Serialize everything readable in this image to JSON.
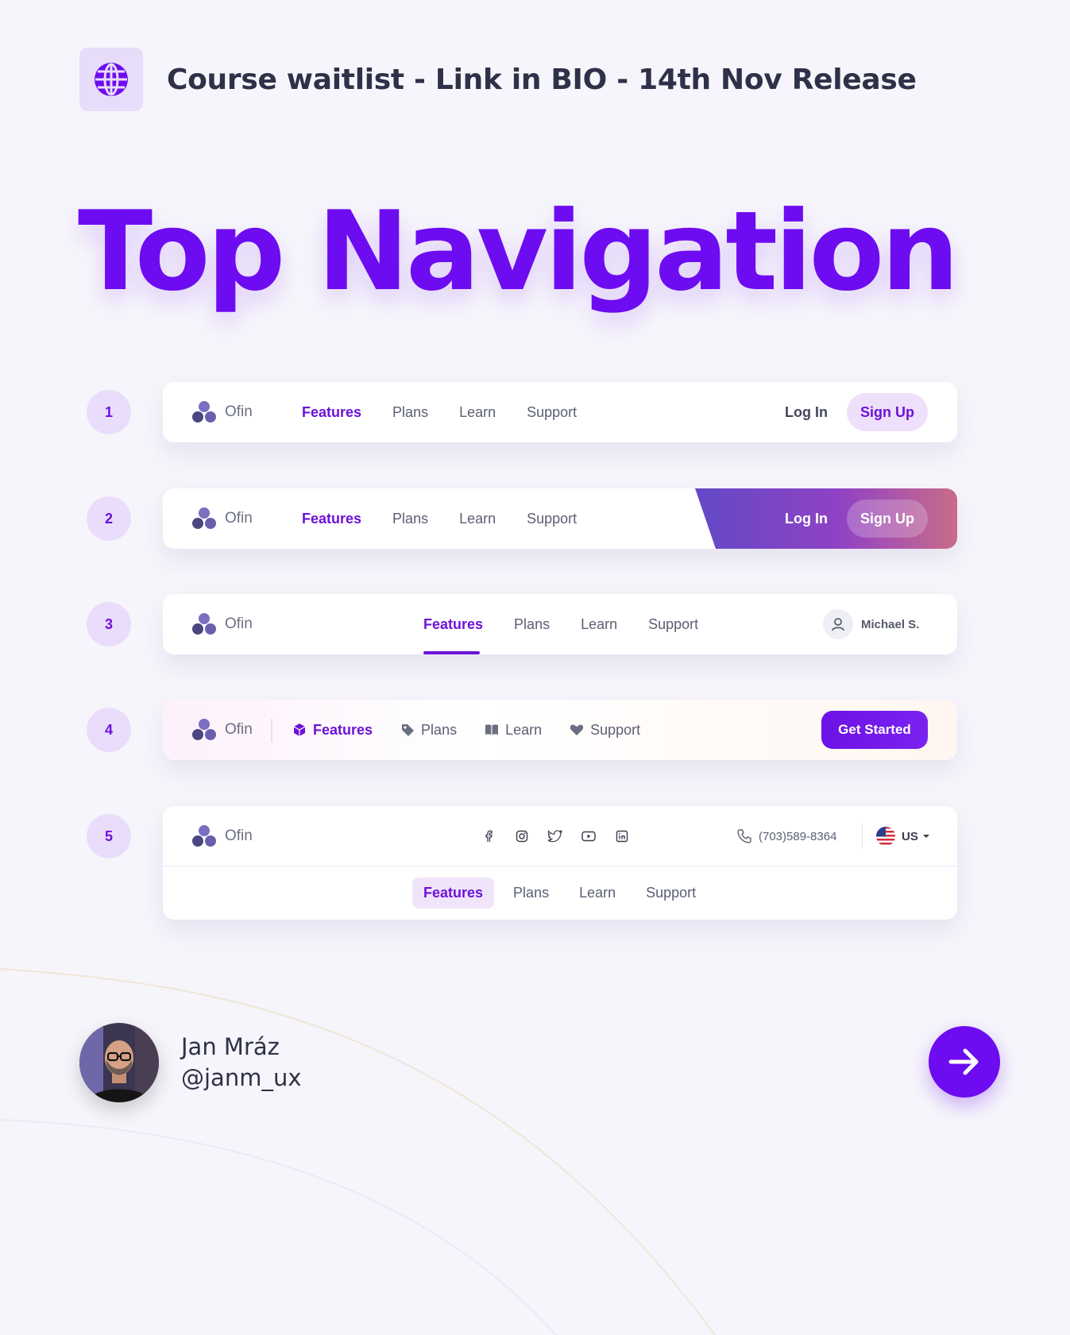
{
  "header": {
    "title": "Course waitlist - Link in BIO - 14th Nov Release",
    "icon": "globe-icon"
  },
  "page_title": "Top Navigation",
  "colors": {
    "accent": "#6d0cf0",
    "accent_soft": "#eadcfb",
    "text": "#3a3d4f"
  },
  "brand": "Ofin",
  "nav_items": [
    "Features",
    "Plans",
    "Learn",
    "Support"
  ],
  "variants": [
    {
      "number": "1",
      "login": "Log In",
      "signup": "Sign Up"
    },
    {
      "number": "2",
      "login": "Log In",
      "signup": "Sign Up"
    },
    {
      "number": "3",
      "user": "Michael S."
    },
    {
      "number": "4",
      "cta": "Get Started",
      "icons": [
        "cube-icon",
        "tag-icon",
        "book-icon",
        "heart-icon"
      ]
    },
    {
      "number": "5",
      "phone": "(703)589-8364",
      "locale": "US",
      "socials": [
        "facebook-icon",
        "instagram-icon",
        "twitter-icon",
        "youtube-icon",
        "linkedin-icon"
      ]
    }
  ],
  "author": {
    "name": "Jan Mráz",
    "handle": "@janm_ux"
  }
}
